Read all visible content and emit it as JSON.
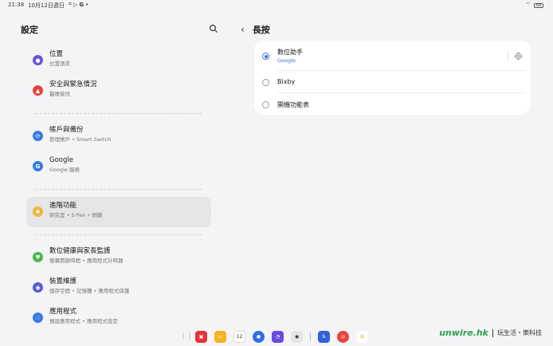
{
  "status": {
    "time": "21:38",
    "date": "10月12日週日",
    "notif_icons": [
      "screenshot-icon",
      "play-icon",
      "google-icon"
    ],
    "dot": "•",
    "battery": "69"
  },
  "left": {
    "title": "設定",
    "items": [
      {
        "title": "位置",
        "subtitle": "位置請求",
        "icon": "location-icon",
        "color": "#6a55d8"
      },
      {
        "title": "安全與緊急情況",
        "subtitle": "醫療資訊",
        "icon": "emergency-icon",
        "color": "#e0463a"
      },
      {
        "title": "帳戶與備份",
        "subtitle": "管理帳戶 • Smart Switch",
        "icon": "sync-icon",
        "color": "#3a7be0"
      },
      {
        "title": "Google",
        "subtitle": "Google 服務",
        "icon": "google-g-icon",
        "color": "#3a7be0"
      },
      {
        "title": "進階功能",
        "subtitle": "研究室 • S Pen • 側鍵",
        "icon": "gear-plus-icon",
        "color": "#f0b73a"
      },
      {
        "title": "數位健康與家長監護",
        "subtitle": "螢幕開啟時間 • 應用程式計時器",
        "icon": "wellbeing-icon",
        "color": "#4cb84e"
      },
      {
        "title": "裝置維護",
        "subtitle": "儲存空間 • 記憶體 • 應用程式保護",
        "icon": "care-icon",
        "color": "#5a5cc8"
      },
      {
        "title": "應用程式",
        "subtitle": "預設應用程式 • 應用程式設定",
        "icon": "apps-icon",
        "color": "#3a7be0"
      }
    ]
  },
  "right": {
    "title": "長按",
    "options": [
      {
        "label": "數位助手",
        "sub": "Google",
        "selected": true
      },
      {
        "label": "Bixby",
        "sub": "",
        "selected": false
      },
      {
        "label": "開機功能表",
        "sub": "",
        "selected": false
      }
    ]
  },
  "taskbar": {
    "apps": [
      {
        "name": "app-grid-icon",
        "color": ""
      },
      {
        "name": "flipboard-icon",
        "color": "#e8333a"
      },
      {
        "name": "notes-icon",
        "color": "#f2b420"
      },
      {
        "name": "calendar-icon",
        "color": "#ffffff",
        "text": "12"
      },
      {
        "name": "messages-icon",
        "color": "#2f6ee8"
      },
      {
        "name": "galaxy-store-icon",
        "color": "#6a4be0"
      },
      {
        "name": "camera-icon",
        "color": "#2a2a2a"
      },
      {
        "name": "bixby-icon",
        "color": "#2e62d8"
      },
      {
        "name": "chrome-icon",
        "color": "#e8453a"
      },
      {
        "name": "photos-icon",
        "color": "#f2b420"
      }
    ]
  },
  "watermark": {
    "logo": "unwire.hk",
    "text": "玩生活・樂科技"
  }
}
